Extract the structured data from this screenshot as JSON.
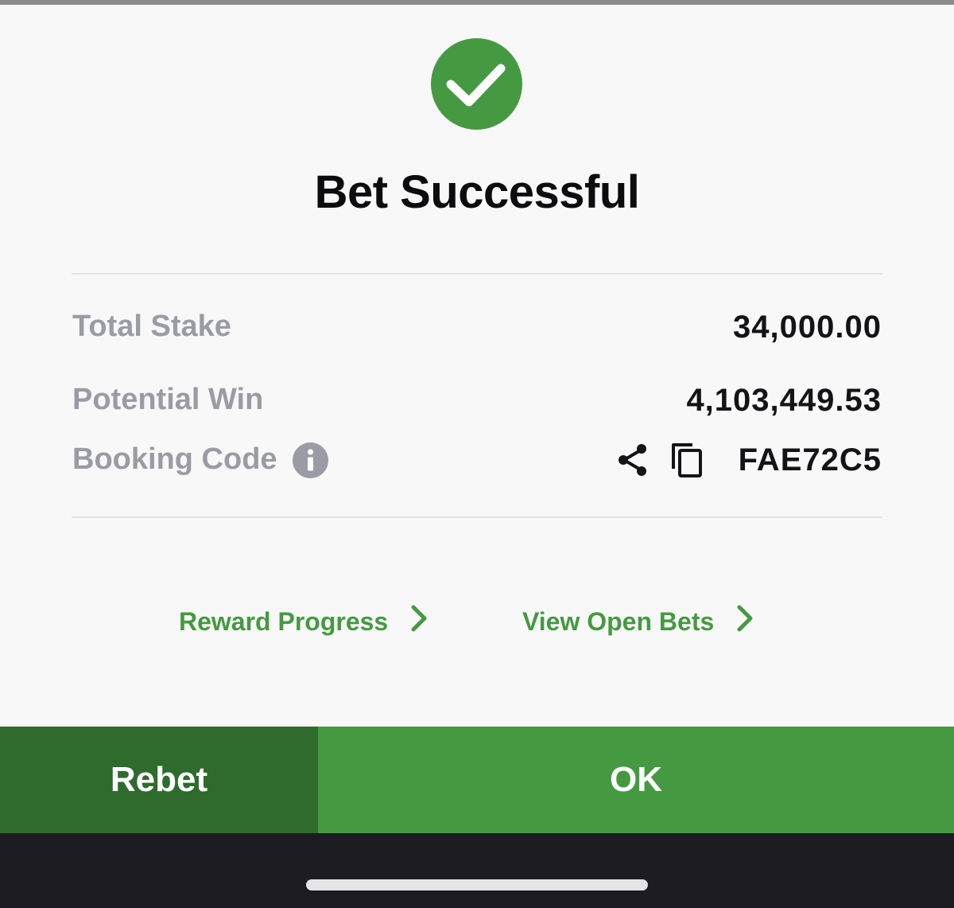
{
  "title": "Bet Successful",
  "summary": {
    "total_stake_label": "Total Stake",
    "total_stake_value": "34,000.00",
    "potential_win_label": "Potential Win",
    "potential_win_value": "4,103,449.53",
    "booking_code_label": "Booking Code",
    "booking_code_value": "FAE72C5"
  },
  "links": {
    "reward_progress": "Reward Progress",
    "view_open_bets": "View Open Bets"
  },
  "buttons": {
    "rebet": "Rebet",
    "ok": "OK"
  },
  "icons": {
    "success": "check-circle-icon",
    "info": "info-icon",
    "share": "share-icon",
    "copy": "copy-icon",
    "chevron": "chevron-right-icon"
  },
  "colors": {
    "accent_green": "#459a41",
    "dark_green": "#2e6b2d",
    "label_gray": "#9a9ba4",
    "background": "#f8f8f8"
  }
}
